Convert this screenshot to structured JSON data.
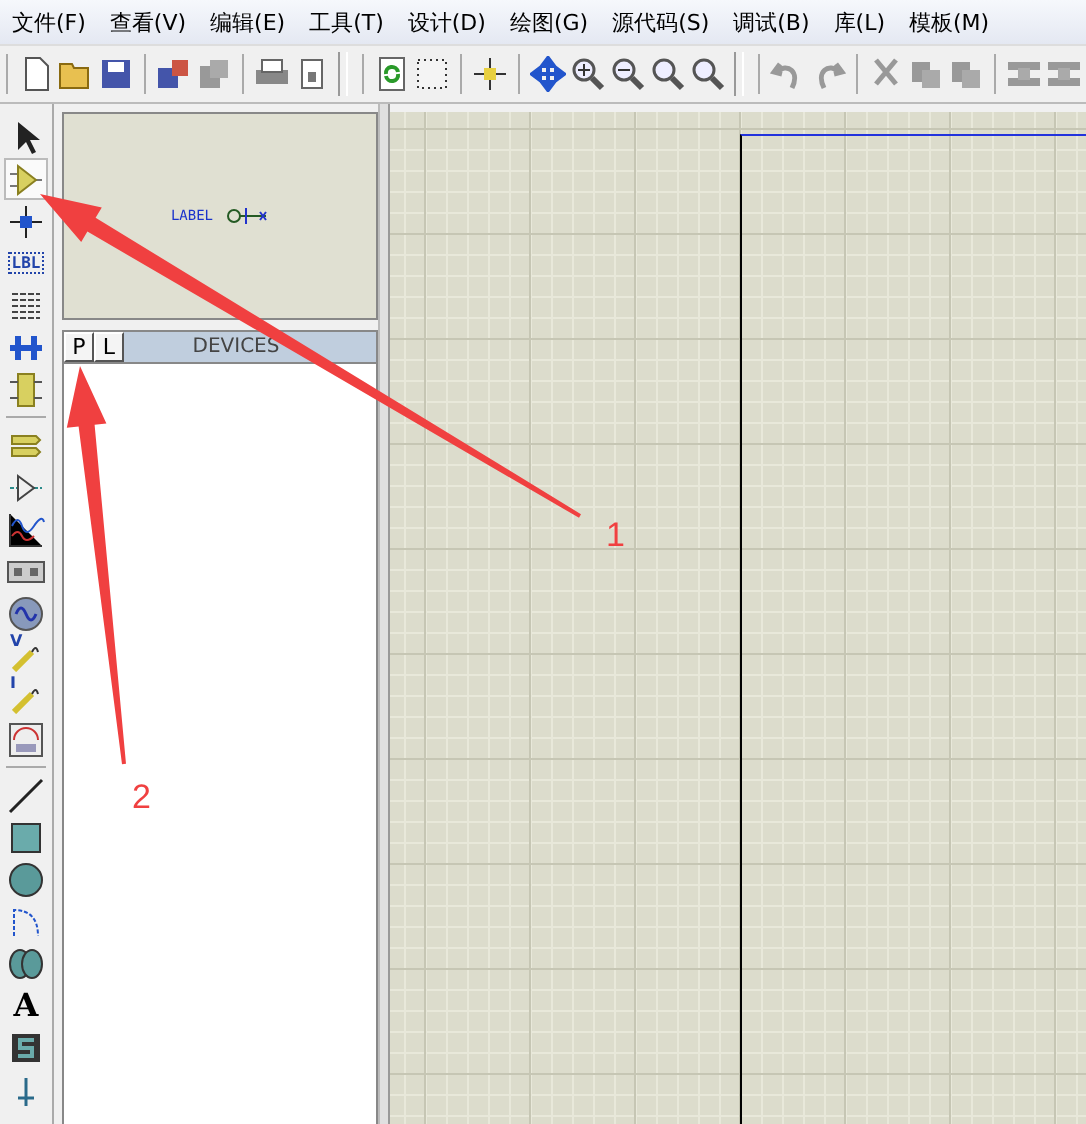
{
  "menu": [
    {
      "label": "文件(F)"
    },
    {
      "label": "查看(V)"
    },
    {
      "label": "编辑(E)"
    },
    {
      "label": "工具(T)"
    },
    {
      "label": "设计(D)"
    },
    {
      "label": "绘图(G)"
    },
    {
      "label": "源代码(S)"
    },
    {
      "label": "调试(B)"
    },
    {
      "label": "库(L)"
    },
    {
      "label": "模板(M)"
    }
  ],
  "tools": [
    {
      "kind": "select",
      "selected": false
    },
    {
      "kind": "component",
      "selected": true
    },
    {
      "kind": "junction",
      "selected": false
    },
    {
      "kind": "label",
      "text": "LBL",
      "selected": false
    },
    {
      "kind": "script",
      "selected": false
    },
    {
      "kind": "bus",
      "selected": false
    },
    {
      "kind": "subcircuit",
      "selected": false
    },
    {
      "kind": "separator"
    },
    {
      "kind": "terminal",
      "selected": false
    },
    {
      "kind": "pin",
      "selected": false
    },
    {
      "kind": "graph",
      "selected": false
    },
    {
      "kind": "tape",
      "selected": false
    },
    {
      "kind": "generator",
      "selected": false
    },
    {
      "kind": "probe",
      "text": "V",
      "selected": false
    },
    {
      "kind": "probe",
      "text": "I",
      "selected": false
    },
    {
      "kind": "instrument",
      "selected": false
    },
    {
      "kind": "separator"
    },
    {
      "kind": "line",
      "selected": false
    },
    {
      "kind": "box",
      "selected": false
    },
    {
      "kind": "circle",
      "selected": false
    },
    {
      "kind": "arc",
      "selected": false
    },
    {
      "kind": "path",
      "selected": false
    },
    {
      "kind": "text",
      "text": "A",
      "selected": false
    },
    {
      "kind": "symbol",
      "selected": false
    },
    {
      "kind": "marker",
      "selected": false
    }
  ],
  "preview": {
    "label": "LABEL"
  },
  "device_panel": {
    "tabs": [
      {
        "label": "P"
      },
      {
        "label": "L"
      }
    ],
    "title": "DEVICES"
  },
  "annotations": [
    {
      "label": "1"
    },
    {
      "label": "2"
    }
  ]
}
